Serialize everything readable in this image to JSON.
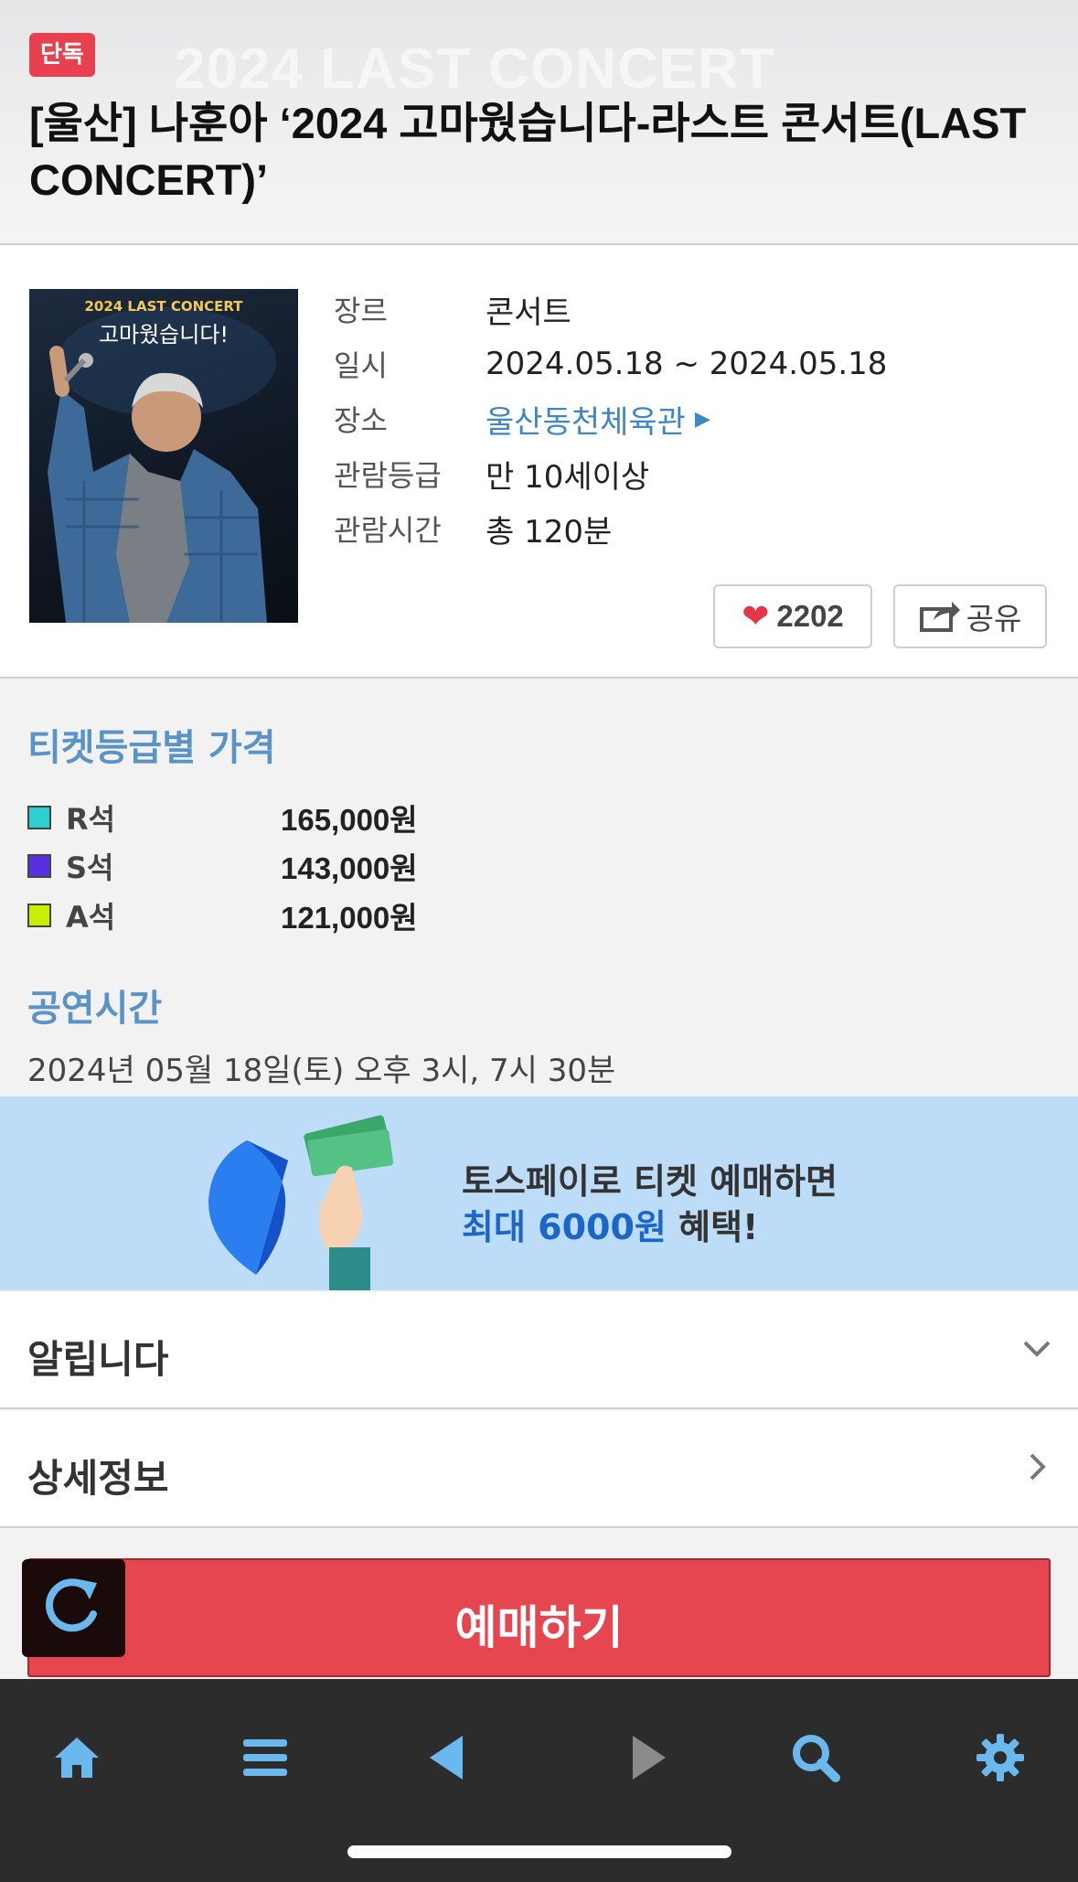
{
  "header": {
    "badge": "단독",
    "title": "[울산] 나훈아 ‘2024 고마웠습니다-라스트 콘서트(LAST CONCERT)’",
    "watermark": "2024 LAST CONCERT"
  },
  "poster": {
    "top_text": "2024 LAST CONCERT",
    "sub_text": "고마웠습니다!"
  },
  "info": {
    "rows": [
      {
        "key": "장르",
        "value": "콘서트"
      },
      {
        "key": "일시",
        "value": "2024.05.18 ~ 2024.05.18"
      },
      {
        "key": "장소",
        "value": "울산동천체육관"
      },
      {
        "key": "관람등급",
        "value": "만 10세이상"
      },
      {
        "key": "관람시간",
        "value": "총 120분"
      }
    ],
    "likes": "2202",
    "share_label": "공유"
  },
  "prices": {
    "title": "티켓등급별 가격",
    "items": [
      {
        "seat": "R석",
        "price": "165,000원",
        "color": "#2ecfcf"
      },
      {
        "seat": "S석",
        "price": "143,000원",
        "color": "#5a2fe0"
      },
      {
        "seat": "A석",
        "price": "121,000원",
        "color": "#c7f000"
      }
    ]
  },
  "showtime": {
    "title": "공연시간",
    "text": "2024년 05월 18일(토) 오후 3시, 7시 30분"
  },
  "promo": {
    "line1": "토스페이로 티켓 예매하면",
    "highlight": "최대 6000원",
    "suffix": " 혜택!"
  },
  "accordion": {
    "notice": "알립니다",
    "details": "상세정보"
  },
  "reserve": {
    "label": "예매하기"
  },
  "nav": {
    "items": [
      "home-icon",
      "menu-icon",
      "back-icon",
      "forward-icon",
      "search-icon",
      "settings-icon"
    ]
  }
}
